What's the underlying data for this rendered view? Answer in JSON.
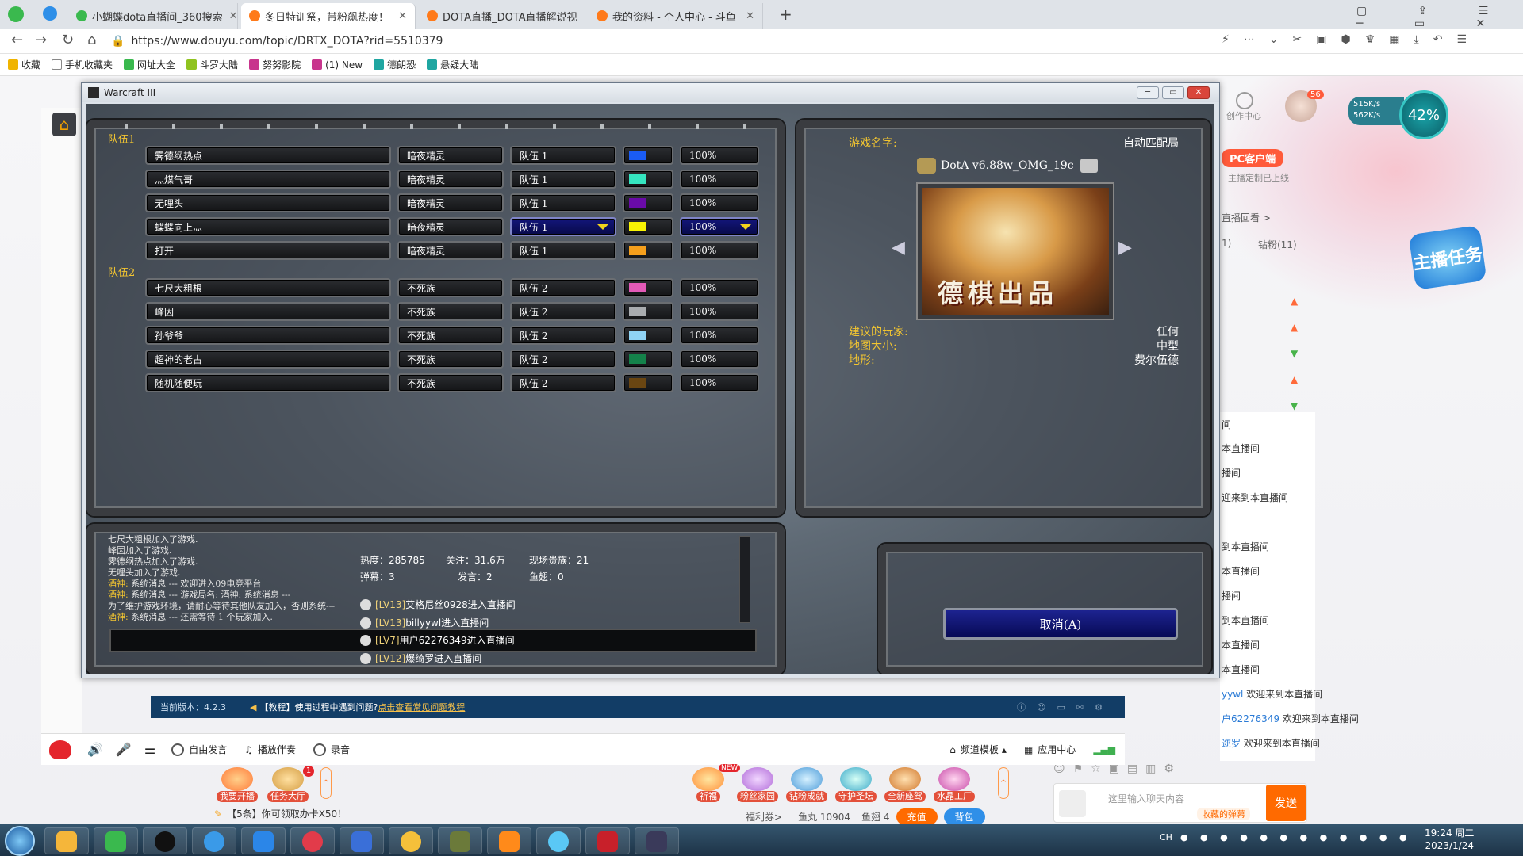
{
  "browser": {
    "tabs": [
      {
        "label": "小蝴蝶dota直播间_360搜索",
        "active": false
      },
      {
        "label": "冬日特训祭，带粉飙热度！",
        "active": true
      },
      {
        "label": "DOTA直播_DOTA直播解说视",
        "active": false
      },
      {
        "label": "我的资料 - 个人中心 - 斗鱼",
        "active": false
      }
    ],
    "url": "https://www.douyu.com/topic/DRTX_DOTA?rid=5510379",
    "bookmarks": [
      "收藏",
      "手机收藏夹",
      "网址大全",
      "斗罗大陆",
      "努努影院",
      "(1) New",
      "德朗恐",
      "悬疑大陆"
    ]
  },
  "wc3": {
    "window_title": "Warcraft III",
    "team1_label": "队伍1",
    "team2_label": "队伍2",
    "players": [
      {
        "name": "霁德纲热点",
        "race": "暗夜精灵",
        "team": "队伍 1",
        "color": "#1a5cf5",
        "handicap": "100%",
        "selected": false
      },
      {
        "name": "灬煤气哥",
        "race": "暗夜精灵",
        "team": "队伍 1",
        "color": "#35e5c0",
        "handicap": "100%",
        "selected": false
      },
      {
        "name": "无哩头",
        "race": "暗夜精灵",
        "team": "队伍 1",
        "color": "#6a0ba8",
        "handicap": "100%",
        "selected": false
      },
      {
        "name": "蝶蝶向上灬",
        "race": "暗夜精灵",
        "team": "队伍 1",
        "color": "#f8f404",
        "handicap": "100%",
        "selected": true
      },
      {
        "name": "打开",
        "race": "暗夜精灵",
        "team": "队伍 1",
        "color": "#f59f1c",
        "handicap": "100%",
        "selected": false
      },
      {
        "name": "七尺大粗根",
        "race": "不死族",
        "team": "队伍 2",
        "color": "#e35ab8",
        "handicap": "100%",
        "selected": false
      },
      {
        "name": "峰因",
        "race": "不死族",
        "team": "队伍 2",
        "color": "#a9acaf",
        "handicap": "100%",
        "selected": false
      },
      {
        "name": "孙爷爷",
        "race": "不死族",
        "team": "队伍 2",
        "color": "#8fd3f5",
        "handicap": "100%",
        "selected": false
      },
      {
        "name": "超神的老占",
        "race": "不死族",
        "team": "队伍 2",
        "color": "#14824a",
        "handicap": "100%",
        "selected": false
      },
      {
        "name": "随机随便玩",
        "race": "不死族",
        "team": "队伍 2",
        "color": "#6a4612",
        "handicap": "100%",
        "selected": false
      }
    ],
    "game_name_label": "游戏名字:",
    "auto_match": "自动匹配局",
    "map_name": "DotA v6.88w_OMG_19c",
    "map_banner_text": "德棋出品",
    "suggested_players_label": "建议的玩家:",
    "suggested_players_value": "任何",
    "map_size_label": "地图大小:",
    "map_size_value": "中型",
    "terrain_label": "地形:",
    "terrain_value": "费尔伍德",
    "chat_lines": [
      {
        "prefix": "",
        "text": "七尺大粗根加入了游戏."
      },
      {
        "prefix": "",
        "text": "峰因加入了游戏."
      },
      {
        "prefix": "",
        "text": "霁德纲热点加入了游戏."
      },
      {
        "prefix": "",
        "text": "无哩头加入了游戏."
      },
      {
        "prefix": "酒神:",
        "text": " 系统消息 ---    欢迎进入09电竞平台"
      },
      {
        "prefix": "酒神:",
        "text": " 系统消息 ---    游戏局名:    酒神: 系统消息 ---"
      },
      {
        "prefix": "",
        "text": "为了维护游戏环境，请耐心等待其他队友加入，否则系统---"
      },
      {
        "prefix": "酒神:",
        "text": " 系统消息 --- 还需等待 1 个玩家加入."
      }
    ],
    "cancel_button": "取消(A)"
  },
  "douyu": {
    "stats": {
      "heat": "热度：285785",
      "follow": "关注：31.6万",
      "nobles": "现场贵族：21",
      "danmu": "弹幕：3",
      "speak": "发言：2",
      "fishball": "鱼翅：0"
    },
    "enter_msgs": [
      {
        "level": "[LV13]",
        "text": "艾格尼丝0928进入直播间"
      },
      {
        "level": "[LV13]",
        "text": "billyywl进入直播间"
      },
      {
        "level": "[LV7]",
        "text": "用户62276349进入直播间"
      },
      {
        "level": "[LV12]",
        "text": "爆绮罗进入直播间"
      }
    ],
    "version": "当前版本：4.2.3",
    "tutorial_prefix": "【教程】使用过程中遇到问题?",
    "tutorial_link": "点击查看常见问题教程",
    "bottom_controls": [
      "自由发言",
      "播放伴奏",
      "录音"
    ],
    "bottom_right": [
      "频道模板",
      "应用中心"
    ],
    "gifts": [
      {
        "label": "我要开播"
      },
      {
        "label": "任务大厅"
      },
      {
        "label": "祈福"
      },
      {
        "label": "粉丝家园"
      },
      {
        "label": "钻粉成就"
      },
      {
        "label": "守护圣坛"
      },
      {
        "label": "全新座驾"
      },
      {
        "label": "水晶工厂"
      }
    ],
    "task_badge": "1",
    "new_badge": "NEW",
    "promo": "【5条】你可领取办卡X50！",
    "welfare": "福利券>",
    "fishball_count": "鱼丸 10904",
    "fishfin_count": "鱼翅 4",
    "recharge": "充值",
    "backpack": "背包",
    "chat_placeholder": "这里输入聊天内容",
    "send": "发送",
    "danmu_label": "收藏的弹幕",
    "pc_client": "PC客户端",
    "pc_client_sub": "主播定制已上线",
    "creator_center": "创作中心",
    "avatar_badge": "56",
    "speed_up": "515K/s",
    "speed_down": "562K/s",
    "speed_percent": "42%",
    "replay": "直播回看 >",
    "tabs_right": [
      "1)",
      "钻粉(11)"
    ],
    "right_chat": [
      {
        "name": "",
        "text": "间"
      },
      {
        "name": "",
        "text": "本直播间"
      },
      {
        "name": "",
        "text": "播间"
      },
      {
        "name": "",
        "text": "迎来到本直播间"
      },
      {
        "name": "",
        "text": "到本直播间"
      },
      {
        "name": "",
        "text": "本直播间"
      },
      {
        "name": "",
        "text": "播间"
      },
      {
        "name": "",
        "text": "到本直播间"
      },
      {
        "name": "",
        "text": "本直播间"
      },
      {
        "name": "",
        "text": "本直播间"
      },
      {
        "name": "yywl",
        "text": " 欢迎来到本直播间"
      },
      {
        "name": "户62276349",
        "text": " 欢迎来到本直播间"
      },
      {
        "name": "迩罗",
        "text": " 欢迎来到本直播间"
      }
    ],
    "promo_badge_right": "主播任务"
  },
  "taskbar": {
    "time": "19:24 周二",
    "date": "2023/1/24",
    "lang": "CH"
  }
}
